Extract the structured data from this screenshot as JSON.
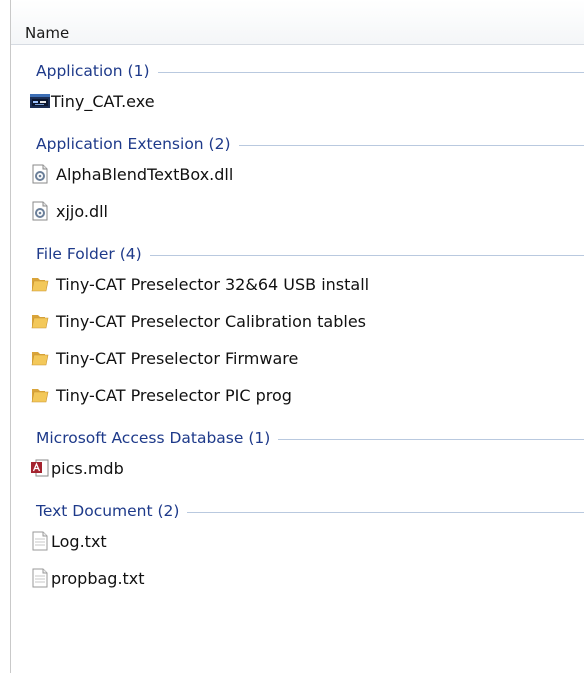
{
  "header": {
    "name_col": "Name"
  },
  "groups": [
    {
      "title": "Application (1)",
      "items": [
        {
          "name": "Tiny_CAT.exe",
          "icon": "exe-app-icon"
        }
      ]
    },
    {
      "title": "Application Extension (2)",
      "items": [
        {
          "name": "AlphaBlendTextBox.dll",
          "icon": "dll-gear-icon"
        },
        {
          "name": "xjjo.dll",
          "icon": "dll-gear-icon"
        }
      ]
    },
    {
      "title": "File Folder (4)",
      "items": [
        {
          "name": "Tiny-CAT Preselector 32&64 USB install",
          "icon": "folder-icon"
        },
        {
          "name": "Tiny-CAT Preselector Calibration tables",
          "icon": "folder-icon"
        },
        {
          "name": "Tiny-CAT Preselector Firmware",
          "icon": "folder-icon"
        },
        {
          "name": "Tiny-CAT Preselector PIC prog",
          "icon": "folder-icon"
        }
      ]
    },
    {
      "title": "Microsoft Access Database (1)",
      "items": [
        {
          "name": "pics.mdb",
          "icon": "access-database-icon"
        }
      ]
    },
    {
      "title": "Text Document (2)",
      "items": [
        {
          "name": "Log.txt",
          "icon": "text-document-icon"
        },
        {
          "name": "propbag.txt",
          "icon": "text-document-icon"
        }
      ]
    }
  ],
  "colors": {
    "group_text": "#1e3a8a",
    "group_line": "#b9c9df"
  }
}
